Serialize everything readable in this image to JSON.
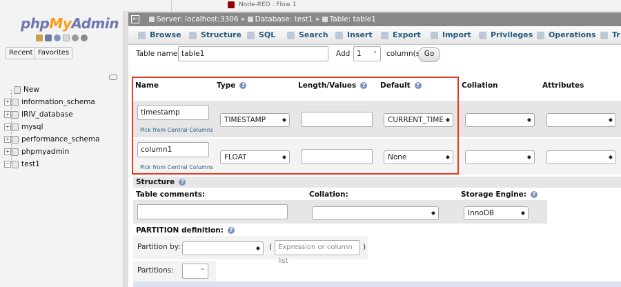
{
  "browser": {
    "tab_title": "Node-RED : Flow 1"
  },
  "nav": {
    "logo": {
      "php": "php",
      "my": "My",
      "admin": "Admin"
    },
    "buttons": {
      "recent": "Recent",
      "favorites": "Favorites"
    },
    "tree": [
      "New",
      "information_schema",
      "IRIV_database",
      "mysql",
      "performance_schema",
      "phpmyadmin",
      "test1"
    ]
  },
  "breadcrumb": {
    "server": "Server: localhost:3306",
    "database": "Database: test1",
    "table": "Table: table1",
    "sep": "»"
  },
  "tabs": [
    "Browse",
    "Structure",
    "SQL",
    "Search",
    "Insert",
    "Export",
    "Import",
    "Privileges",
    "Operations",
    "Tr"
  ],
  "form": {
    "table_name_label": "Table name:",
    "table_name_value": "table1",
    "add_label": "Add",
    "add_value": "1",
    "columns_label": "column(s)",
    "go_label": "Go"
  },
  "columns_header": {
    "name": "Name",
    "type": "Type",
    "length": "Length/Values",
    "default": "Default",
    "collation": "Collation",
    "attributes": "Attributes"
  },
  "rows": [
    {
      "name": "timestamp",
      "pick": "Pick from Central Columns",
      "type": "TIMESTAMP",
      "length": "",
      "default": "CURRENT_TIME",
      "collation": "",
      "attributes": ""
    },
    {
      "name": "column1",
      "pick": "Pick from Central Columns",
      "type": "FLOAT",
      "length": "",
      "default": "None",
      "collation": "",
      "attributes": ""
    }
  ],
  "structure": {
    "title": "Structure",
    "comments_label": "Table comments:",
    "collation_label": "Collation:",
    "engine_label": "Storage Engine:",
    "engine_value": "InnoDB",
    "comments_value": "",
    "collation_value": ""
  },
  "partition": {
    "title": "PARTITION definition:",
    "by_label": "Partition by:",
    "by_value": "",
    "expr_open": "(",
    "expr_placeholder": "Expression or column list",
    "expr_close": ")",
    "partitions_label": "Partitions:",
    "partitions_value": ""
  },
  "colors": {
    "accent_red": "#e8381f",
    "link_blue": "#235a81",
    "breadcrumb_bg": "#888888"
  }
}
